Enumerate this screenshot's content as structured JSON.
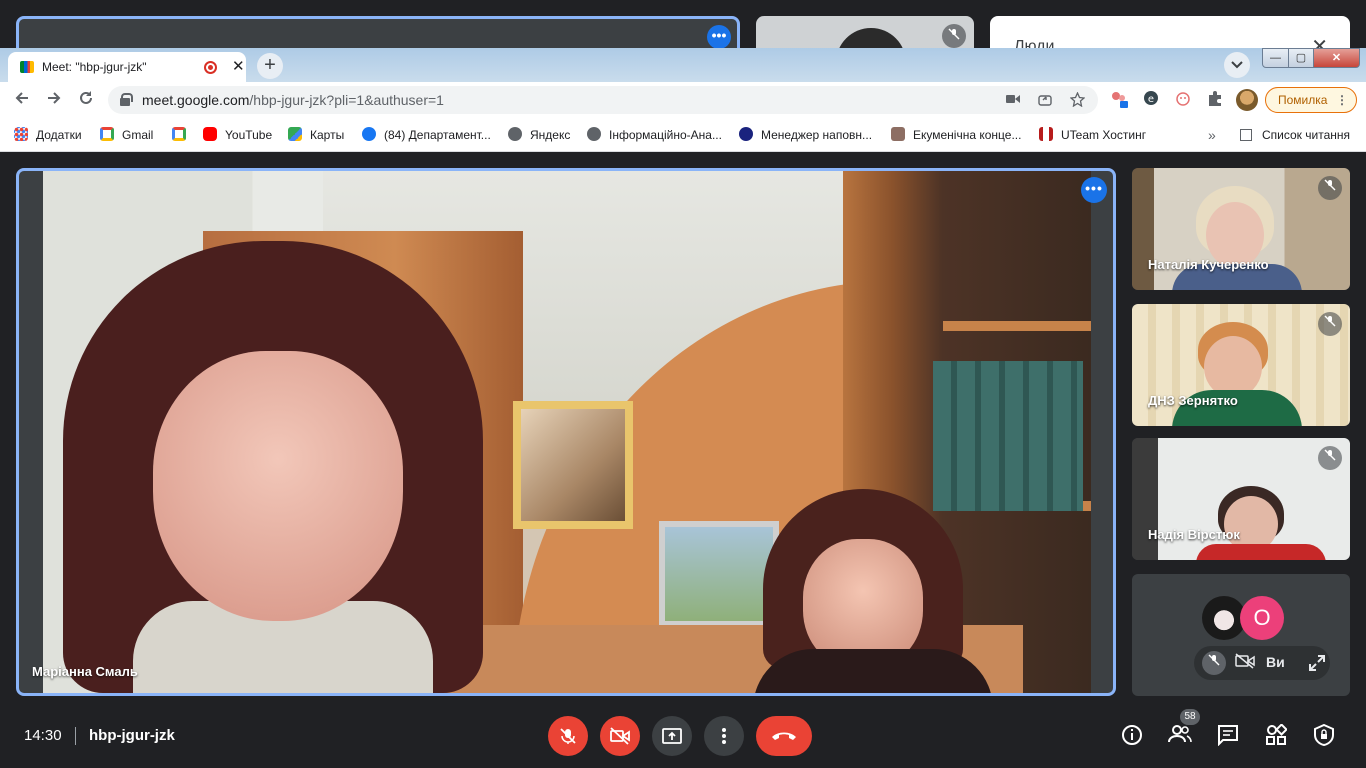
{
  "background_meet": {
    "people_panel_title": "Люди",
    "people_close": "✕",
    "tile_more": "•••"
  },
  "browser": {
    "tab": {
      "title": "Meet: \"hbp-jgur-jzk\"",
      "close": "✕"
    },
    "new_tab": "+",
    "tab_search": "⌄",
    "window_controls": {
      "minimize": "—",
      "maximize": "▢",
      "close": "✕"
    },
    "url_host": "meet.google.com",
    "url_path": "/hbp-jgur-jzk?pli=1&authuser=1",
    "error_button": "Помилка",
    "bookmarks": [
      {
        "label": "Додатки",
        "icon": "apps-grid-icon",
        "color": "#ea4335"
      },
      {
        "label": "Gmail",
        "icon": "gmail-icon",
        "color": "#ea4335"
      },
      {
        "label": "",
        "icon": "gmail-icon",
        "color": "#ea4335"
      },
      {
        "label": "YouTube",
        "icon": "youtube-icon",
        "color": "#ff0000"
      },
      {
        "label": "Карты",
        "icon": "maps-icon",
        "color": "#34a853"
      },
      {
        "label": "(84) Департамент...",
        "icon": "facebook-icon",
        "color": "#1877f2"
      },
      {
        "label": "Яндекс",
        "icon": "globe-icon",
        "color": "#5f6368"
      },
      {
        "label": "Інформаційно-Ана...",
        "icon": "globe-icon",
        "color": "#5f6368"
      },
      {
        "label": "Менеджер наповн...",
        "icon": "site-icon",
        "color": "#1a237e"
      },
      {
        "label": "Екуменічна конце...",
        "icon": "site-icon",
        "color": "#8d6e63"
      },
      {
        "label": "UTeam Хостинг",
        "icon": "ut-icon",
        "color": "#b71c1c"
      }
    ],
    "bookmarks_more": "»",
    "reading_list": "Список читання"
  },
  "meet": {
    "main_tile_name": "Маріанна Смаль",
    "tile_more": "•••",
    "side_tiles": [
      {
        "name": "Наталія Кучеренко"
      },
      {
        "name": "ДНЗ Зернятко"
      },
      {
        "name": "Надія Вірстюк"
      }
    ],
    "self_tile": {
      "avatar_letter": "О",
      "label": "Ви"
    },
    "time": "14:30",
    "meeting_code": "hbp-jgur-jzk",
    "participants_count": "58"
  },
  "colors": {
    "accent": "#8ab4f8",
    "danger": "#ea4335",
    "bar_bg": "#202124"
  }
}
